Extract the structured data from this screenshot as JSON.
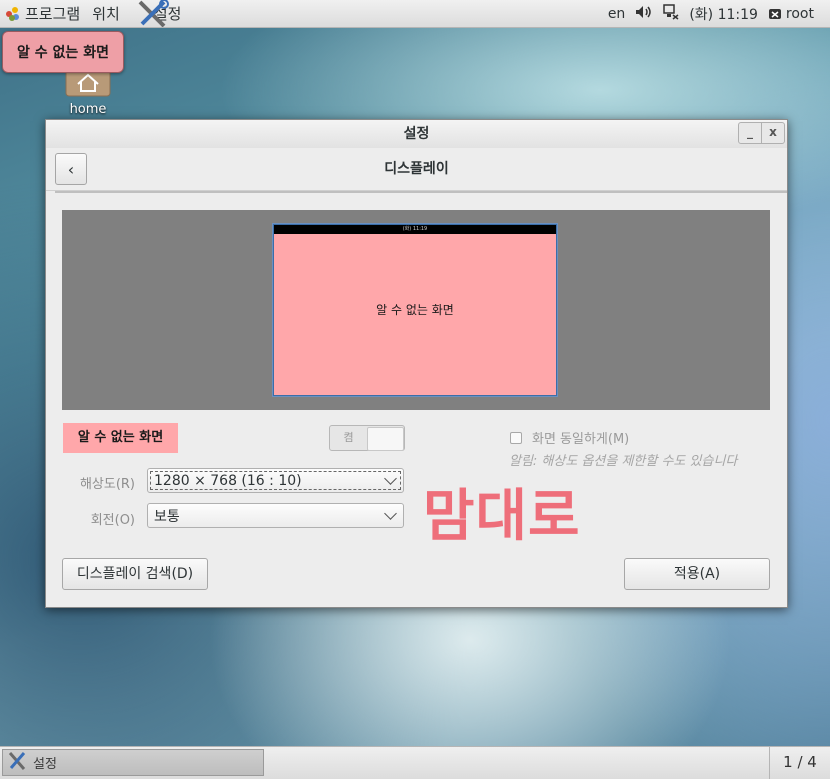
{
  "top_panel": {
    "applications": "프로그램",
    "places": "위치",
    "settings": "설정",
    "keyboard_layout": "en",
    "clock": "(화) 11:19",
    "user": "root"
  },
  "desktop": {
    "screen_label": "알 수 없는 화면",
    "home_label": "home"
  },
  "window": {
    "title": "설정",
    "minimize": "_",
    "close": "x",
    "header_title": "디스플레이",
    "preview_clock": "(화) 11:19",
    "preview_name": "알 수 없는 화면",
    "display_name": "알 수 없는 화면",
    "toggle_label": "켬",
    "mirror_label": "화면 동일하게(M)",
    "note": "알림: 해상도 옵션을 제한할 수도 있습니다",
    "resolution_label": "해상도(R)",
    "resolution_value": "1280 × 768 (16 : 10)",
    "rotation_label": "회전(O)",
    "rotation_value": "보통",
    "watermark": "맘대로",
    "detect_button": "디스플레이 검색(D)",
    "apply_button": "적용(A)"
  },
  "bottom_panel": {
    "task_label": "설정",
    "pager": "1 / 4"
  },
  "colors": {
    "monitor_fill": "#ffa7aa",
    "watermark": "#ee6e7a",
    "preview_bg": "#808080"
  }
}
